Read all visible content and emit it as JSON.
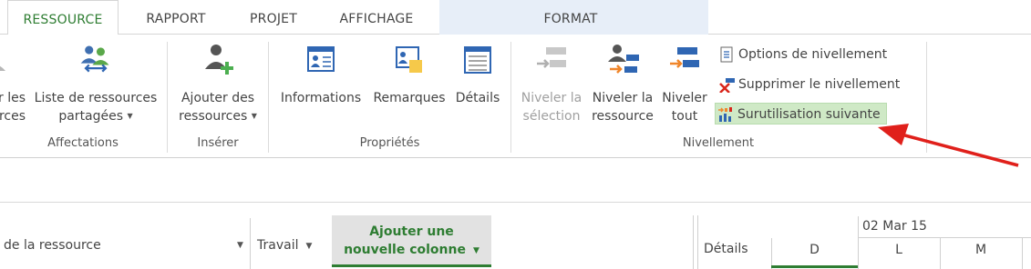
{
  "tabs": [
    {
      "label": "RESSOURCE",
      "active": true
    },
    {
      "label": "RAPPORT",
      "active": false
    },
    {
      "label": "PROJET",
      "active": false
    },
    {
      "label": "AFFICHAGE",
      "active": false
    },
    {
      "label": "FORMAT",
      "active": false
    }
  ],
  "ribbon": {
    "affectations": {
      "partial_label_line1": "r les",
      "partial_label_line2": "rces",
      "shared_pool_line1": "Liste de ressources",
      "shared_pool_line2": "partagées",
      "group_label": "Affectations"
    },
    "inserer": {
      "add_line1": "Ajouter des",
      "add_line2": "ressources",
      "group_label": "Insérer"
    },
    "proprietes": {
      "informations": "Informations",
      "remarques": "Remarques",
      "details": "Détails",
      "group_label": "Propriétés"
    },
    "nivellement": {
      "level_sel_line1": "Niveler la",
      "level_sel_line2": "sélection",
      "level_res_line1": "Niveler la",
      "level_res_line2": "ressource",
      "level_all_line1": "Niveler",
      "level_all_line2": "tout",
      "options": "Options de nivellement",
      "clear": "Supprimer le nivellement",
      "next_overalloc": "Surutilisation suivante",
      "group_label": "Nivellement"
    }
  },
  "sheet": {
    "col_name": "de la ressource",
    "col_work": "Travail",
    "add_col_line1": "Ajouter une",
    "add_col_line2": "nouvelle colonne"
  },
  "calendar": {
    "details_label": "Détails",
    "week_label": "02 Mar 15",
    "days": [
      "D",
      "L",
      "M"
    ]
  },
  "colors": {
    "accent_green": "#2e7d32",
    "highlight": "#cfe9c6",
    "arrow_red": "#e0201b",
    "context_band": "#e7eef8"
  }
}
